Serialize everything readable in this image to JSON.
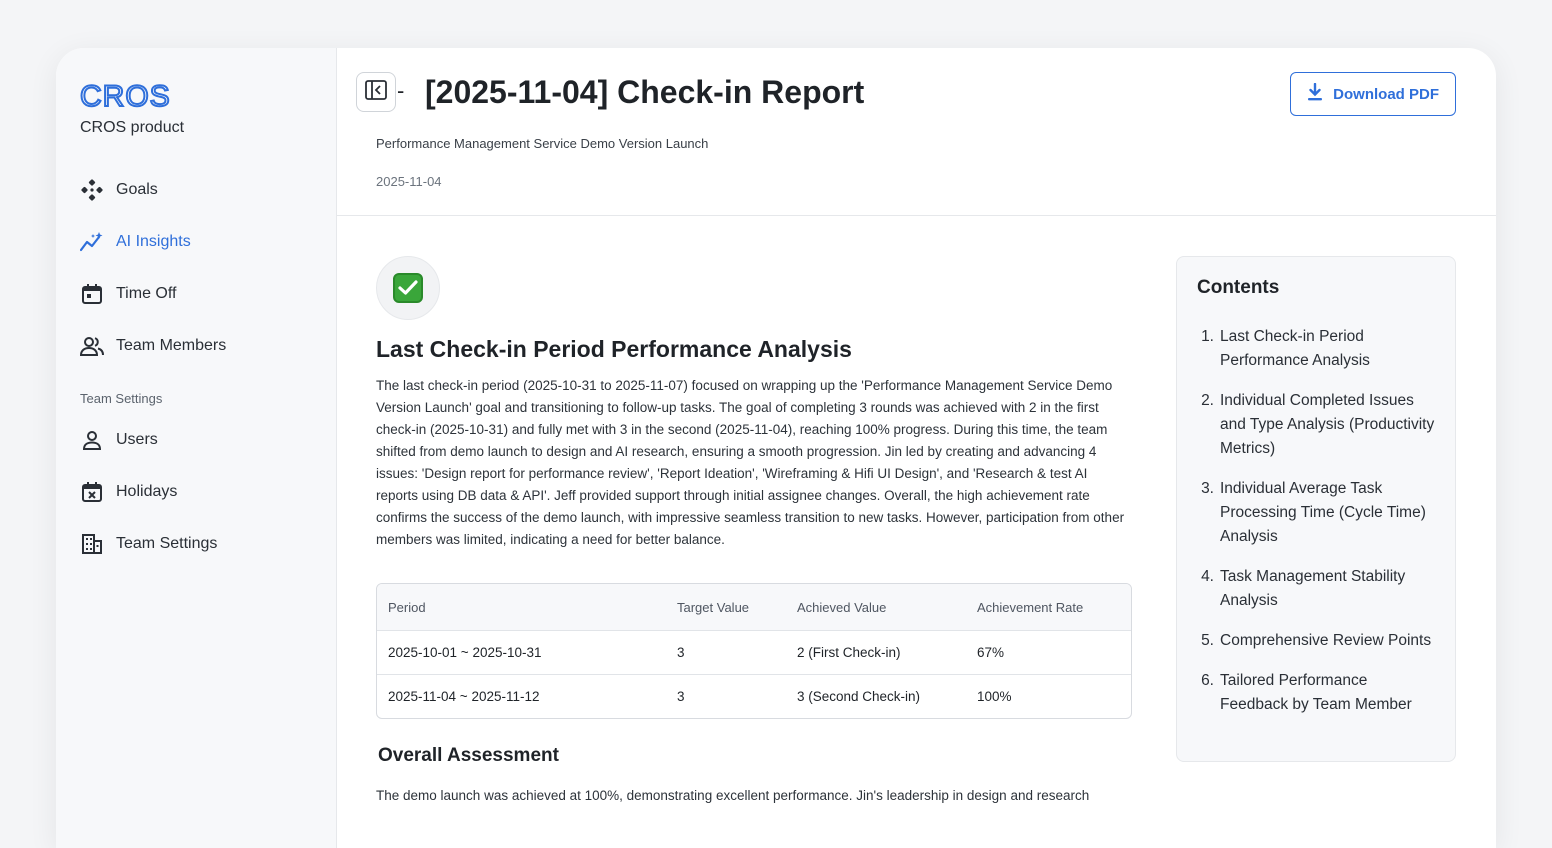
{
  "sidebar": {
    "logo": "CROS",
    "product": "CROS product",
    "nav": [
      {
        "label": "Goals",
        "icon": "goals-icon"
      },
      {
        "label": "AI Insights",
        "icon": "ai-insights-icon",
        "active": true
      },
      {
        "label": "Time Off",
        "icon": "calendar-icon"
      },
      {
        "label": "Team Members",
        "icon": "people-icon"
      }
    ],
    "section_label": "Team Settings",
    "settings": [
      {
        "label": "Users",
        "icon": "user-icon"
      },
      {
        "label": "Holidays",
        "icon": "calendar-x-icon"
      },
      {
        "label": "Team Settings",
        "icon": "building-icon"
      }
    ],
    "accent": "#2f6fda"
  },
  "header": {
    "title": "[2025-11-04] Check-in Report",
    "subtitle": "Performance Management Service Demo Version Launch",
    "date": "2025-11-04",
    "download_label": "Download PDF"
  },
  "main": {
    "section_title": "Last Check-in Period Performance Analysis",
    "paragraph": "The last check-in period (2025-10-31 to 2025-11-07) focused on wrapping up the 'Performance Management Service Demo Version Launch' goal and transitioning to follow-up tasks. The goal of completing 3 rounds was achieved with 2 in the first check-in (2025-10-31) and fully met with 3 in the second (2025-11-04), reaching 100% progress. During this time, the team shifted from demo launch to design and AI research, ensuring a smooth progression. Jin led by creating and advancing 4 issues: 'Design report for performance review', 'Report Ideation', 'Wireframing & Hifi UI Design', and 'Research & test AI reports using DB data & API'. Jeff provided support through initial assignee changes. Overall, the high achievement rate confirms the success of the demo launch, with impressive seamless transition to new tasks. However, participation from other members was limited, indicating a need for better balance.",
    "table": {
      "headers": [
        "Period",
        "Target Value",
        "Achieved Value",
        "Achievement Rate"
      ],
      "rows": [
        [
          "2025-10-01 ~ 2025-10-31",
          "3",
          "2 (First Check-in)",
          "67%"
        ],
        [
          "2025-11-04 ~ 2025-11-12",
          "3",
          "3 (Second Check-in)",
          "100%"
        ]
      ]
    },
    "assessment_title": "Overall Assessment",
    "assessment_text": "The demo launch was achieved at 100%, demonstrating excellent performance. Jin's leadership in design and research"
  },
  "toc": {
    "title": "Contents",
    "items": [
      "Last Check-in Period Performance Analysis",
      "Individual Completed Issues and Type Analysis (Productivity Metrics)",
      "Individual Average Task Processing Time (Cycle Time) Analysis",
      "Task Management Stability Analysis",
      "Comprehensive Review Points",
      "Tailored Performance Feedback by Team Member"
    ]
  }
}
